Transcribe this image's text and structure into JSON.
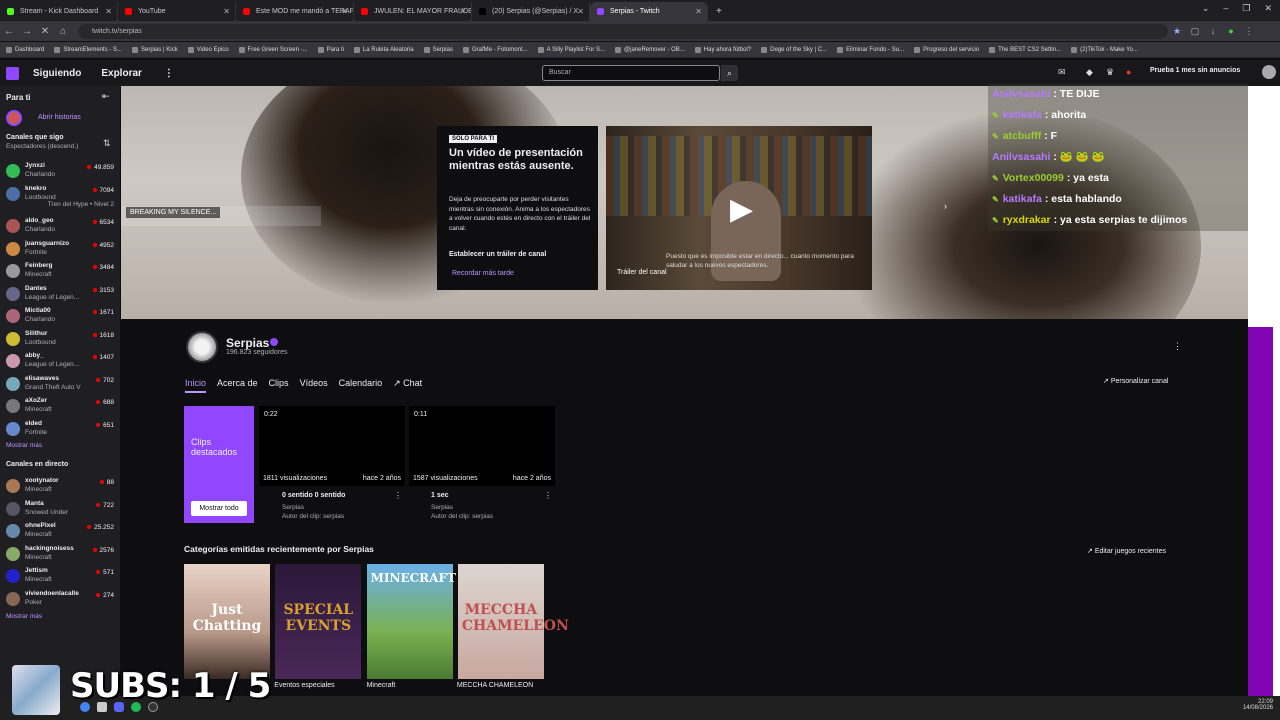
{
  "tabs": [
    {
      "title": "Stream - Kick Dashboard",
      "color": "#53fc18"
    },
    {
      "title": "YouTube",
      "color": "#ff0000"
    },
    {
      "title": "Este MOD me mandó a TERAPI",
      "color": "#ff0000"
    },
    {
      "title": "JWULEN: EL MAYOR FRAUDE D",
      "color": "#ff0000"
    },
    {
      "title": "(20) Serpias (@Serpias) / X",
      "color": "#000000"
    },
    {
      "title": "Serpias - Twitch",
      "color": "#9147ff",
      "active": true
    }
  ],
  "url": "twitch.tv/serpias",
  "bookmarks": [
    "Dashboard",
    "StreamElements - S...",
    "Serpias | Kick",
    "Video Epico",
    "Free Green Screen -...",
    "Para ti",
    "La Ruleta Aleatoria",
    "Serpias",
    "GrafMe - Fotomont...",
    "A Silly Playlist For S...",
    "@janeRemover - OB...",
    "Hay ahora fútbol?",
    "Dege of the Sky | C...",
    "Eliminar Fondo - Su...",
    "Progreso del servicio",
    "The BEST CS2 Settin...",
    "(2)TikTok - Make Yo..."
  ],
  "topnav": {
    "siguiendo": "Siguiendo",
    "explorar": "Explorar",
    "search_placeholder": "Buscar",
    "prime": "Prueba 1 mes sin anuncios"
  },
  "sidebar": {
    "para_ti": "Para ti",
    "abrir_historias": "Abrir historias",
    "canales_que_sigo": "Canales que sigo",
    "sort": "Espectadores (descend.)",
    "followed": [
      {
        "name": "Jynxzi",
        "game": "Charlando",
        "viewers": "49.859",
        "color": "#3b5"
      },
      {
        "name": "knekro",
        "game": "Lootbound",
        "viewers": "7094",
        "color": "#4a6fa5"
      },
      {
        "name": "aldo_geo",
        "game": "Charlando",
        "viewers": "6534",
        "color": "#a55"
      },
      {
        "name": "juansguarnizo",
        "game": "Fortnite",
        "viewers": "4952",
        "color": "#c84"
      },
      {
        "name": "Feinberg",
        "game": "Minecraft",
        "viewers": "3484",
        "color": "#999"
      },
      {
        "name": "Dantes",
        "game": "League of Legen...",
        "viewers": "3153",
        "color": "#668"
      },
      {
        "name": "Mictia00",
        "game": "Charlando",
        "viewers": "1671",
        "color": "#a67"
      },
      {
        "name": "Silithur",
        "game": "Lootbound",
        "viewers": "1618",
        "color": "#cb3"
      },
      {
        "name": "abby_",
        "game": "League of Legen...",
        "viewers": "1407",
        "color": "#c9a"
      },
      {
        "name": "elisawaves",
        "game": "Grand Theft Auto V",
        "viewers": "702",
        "color": "#7ab"
      },
      {
        "name": "aXoZer",
        "game": "Minecraft",
        "viewers": "688",
        "color": "#777"
      },
      {
        "name": "elded",
        "game": "Fortnite",
        "viewers": "651",
        "color": "#68c"
      }
    ],
    "hype_train": "Tren del Hype • Nivel 2",
    "mostrar_mas_1": "Mostrar más",
    "canales_en_directo": "Canales en directo",
    "live": [
      {
        "name": "xootynator",
        "game": "Minecraft",
        "viewers": "88",
        "color": "#a75"
      },
      {
        "name": "Manta",
        "game": "Snowed Under",
        "viewers": "722",
        "color": "#556"
      },
      {
        "name": "ohnePixel",
        "game": "Minecraft",
        "viewers": "25.252",
        "color": "#68a"
      },
      {
        "name": "hackingnoisess",
        "game": "Minecraft",
        "viewers": "2576",
        "color": "#8a6"
      },
      {
        "name": "Jettism",
        "game": "Minecraft",
        "viewers": "571",
        "color": "#22c"
      },
      {
        "name": "viviendoenlacalle",
        "game": "Poker",
        "viewers": "274",
        "color": "#865"
      }
    ],
    "mostrar_mas_2": "Mostrar más"
  },
  "hero": {
    "breaking": "BREAKING MY SILENCE...",
    "solo_para_ti": "SOLO PARA TI",
    "trailer_title": "Un vídeo de presentación mientras estás ausente.",
    "trailer_desc": "Deja de preocuparte por perder visitantes mientras sin conexión. Anima a los espectadores a volver cuando estés en directo con el tráiler del canal.",
    "btn_establecer": "Establecer un tráiler de canal",
    "btn_recordar": "Recordar más tarde",
    "trailer_label": "Tráiler del canal",
    "trailer_caption": "Puesto que es imposible estar en directo... cuanto momento para saludar a los nuevos espectadores."
  },
  "chat": [
    {
      "user": "Anilvsasahi",
      "msg": ": TE DIJE",
      "color": "#b57bff"
    },
    {
      "user": "katikafa",
      "msg": ": ahorita",
      "color": "#b57bff"
    },
    {
      "user": "atcbufff",
      "msg": ": F",
      "color": "#9acd32"
    },
    {
      "user": "Anilvsasahi",
      "msg": ": 🐸 🐸 🐸",
      "color": "#b57bff"
    },
    {
      "user": "Vortex00099",
      "msg": ": ya esta",
      "color": "#9acd32"
    },
    {
      "user": "katikafa",
      "msg": ": esta hablando",
      "color": "#b57bff"
    },
    {
      "user": "ryxdrakar",
      "msg": ": ya esta serpias te dijimos",
      "color": "#d8d800"
    }
  ],
  "channel": {
    "name": "Serpias",
    "followers": "196.823 seguidores",
    "tabs": [
      "Inicio",
      "Acerca de",
      "Clips",
      "Vídeos",
      "Calendario",
      "Chat"
    ],
    "personalizar": "Personalizar canal"
  },
  "clips": {
    "featured_title": "Clips destacados",
    "mostrar_todo": "Mostrar todo",
    "items": [
      {
        "duration": "0:22",
        "views": "1811 visualizaciones",
        "age": "hace 2 años",
        "title": "0 sentido 0 sentido",
        "channel": "Serpias",
        "author": "Autor del clip: serpias"
      },
      {
        "duration": "0:11",
        "views": "1587 visualizaciones",
        "age": "hace 2 años",
        "title": "1 sec",
        "channel": "Serpias",
        "author": "Autor del clip: serpias"
      }
    ]
  },
  "categories": {
    "heading": "Categorías emitidas recientemente por Serpias",
    "edit": "Editar juegos recientes",
    "items": [
      {
        "label": "",
        "art": "Just Chatting"
      },
      {
        "label": "Eventos especiales",
        "art": "SPECIAL EVENTS"
      },
      {
        "label": "Minecraft",
        "art": "MINECRAFT"
      },
      {
        "label": "MECCHA CHAMELEON",
        "art": "MECCHA CHAMELEON"
      }
    ]
  },
  "overlay": {
    "subs": "SUBS: 1 / 5"
  },
  "taskbar": {
    "time": "22:09",
    "date": "14/08/2026"
  }
}
